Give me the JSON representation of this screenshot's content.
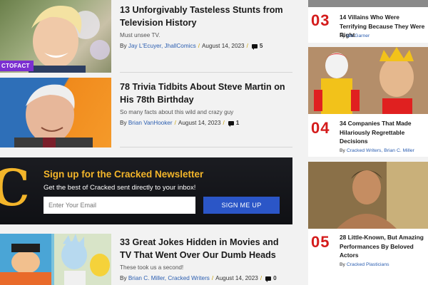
{
  "articles": [
    {
      "title": "13 Unforgivably Tasteless Stunts from Television History",
      "description": "Must unsee TV.",
      "by": "By",
      "authors": "Jay L'Ecuyer, JhallComics",
      "date": "August 14, 2023",
      "comments": "5",
      "badge": "CTOFACT"
    },
    {
      "title": "78 Trivia Tidbits About Steve Martin on His 78th Birthday",
      "description": "So many facts about this wild and crazy guy",
      "by": "By",
      "authors": "Brian VanHooker",
      "date": "August 14, 2023",
      "comments": "1"
    },
    {
      "title": "33 Great Jokes Hidden in Movies and TV That Went Over Our Dumb Heads",
      "description": "These took us a second!",
      "by": "By",
      "authors": "Brian C. Miller, Cracked Writers",
      "date": "August 14, 2023",
      "comments": "0"
    }
  ],
  "newsletter": {
    "logo_letter": "C",
    "title": "Sign up for the Cracked Newsletter",
    "subtitle": "Get the best of Cracked sent directly to your inbox!",
    "email_placeholder": "Enter Your Email",
    "button": "SIGN ME UP"
  },
  "sidebar": [
    {
      "rank": "03",
      "title": "14 Villains Who Were Terrifying Because They Were Right",
      "by": "By",
      "authors": "Ian Garner"
    },
    {
      "rank": "04",
      "title": "34 Companies That Made Hilariously Regrettable Decisions",
      "by": "By",
      "authors": "Cracked Writers, Brian C. Miller"
    },
    {
      "rank": "05",
      "title": "28 Little-Known, But Amazing Performances By Beloved Actors",
      "by": "By",
      "authors": "Cracked Plasticians"
    }
  ],
  "colors": {
    "accent_red": "#d41b1b",
    "link_blue": "#2a5db0",
    "newsletter_gold": "#f3b52a",
    "button_blue": "#2b56c7",
    "badge_purple": "#7b2fd1"
  }
}
